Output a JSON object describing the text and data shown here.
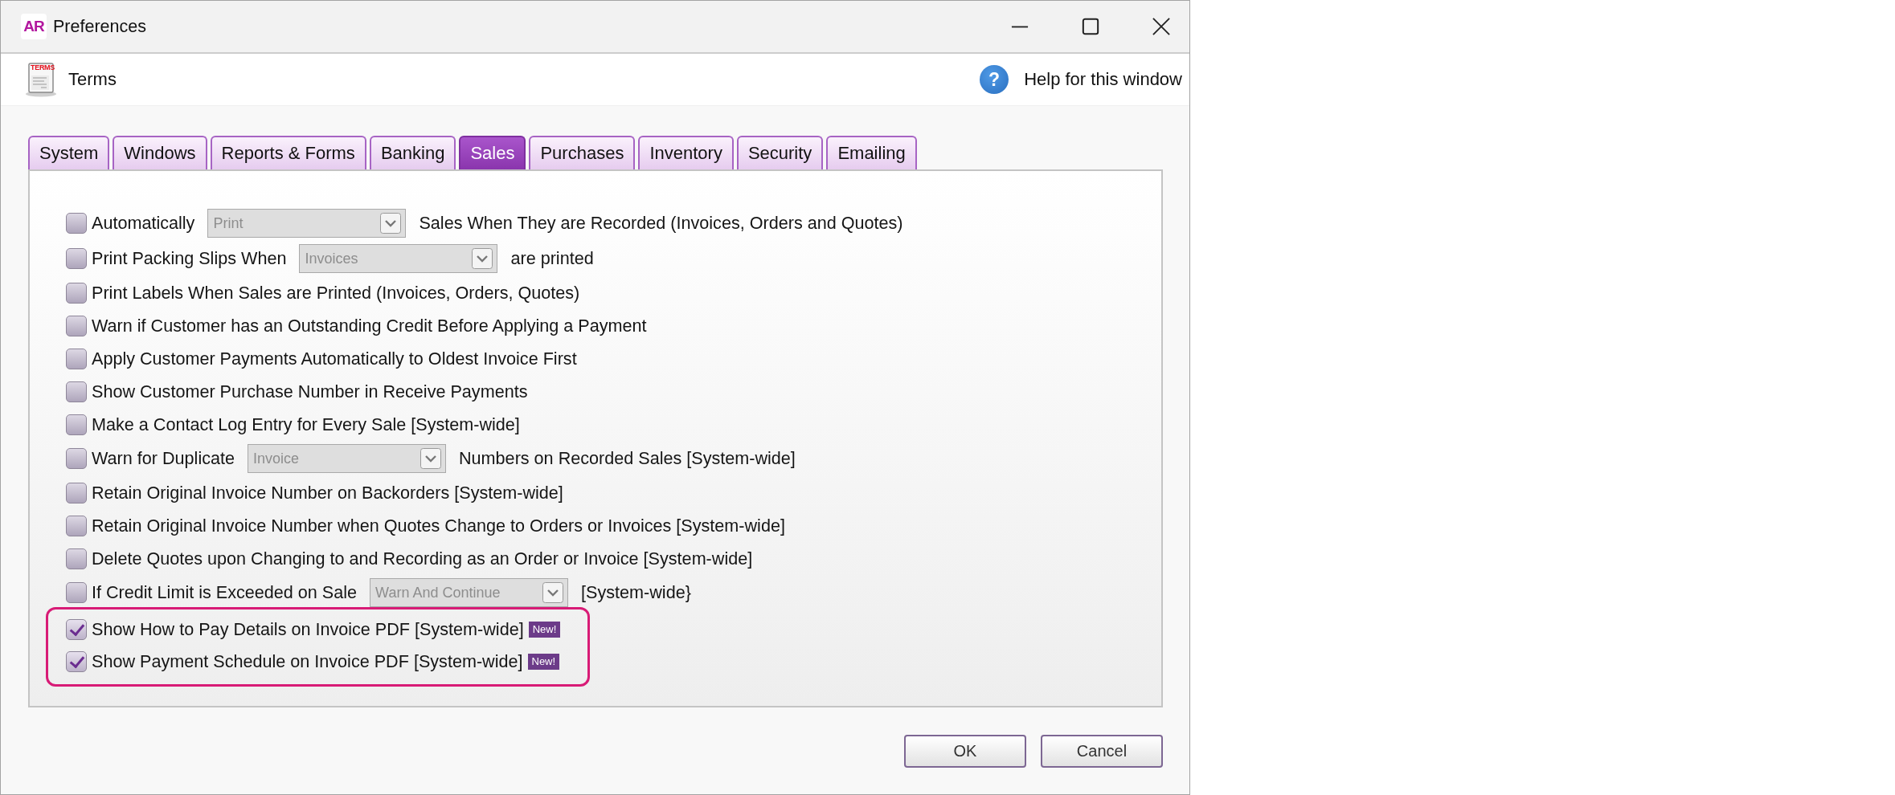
{
  "window": {
    "logo": "AR",
    "title": "Preferences"
  },
  "header": {
    "icon_text": "TERMS",
    "title": "Terms",
    "help_icon": "?",
    "help_link": "Help for this window"
  },
  "tabs": [
    {
      "label": "System",
      "selected": false
    },
    {
      "label": "Windows",
      "selected": false
    },
    {
      "label": "Reports & Forms",
      "selected": false
    },
    {
      "label": "Banking",
      "selected": false
    },
    {
      "label": "Sales",
      "selected": true
    },
    {
      "label": "Purchases",
      "selected": false
    },
    {
      "label": "Inventory",
      "selected": false
    },
    {
      "label": "Security",
      "selected": false
    },
    {
      "label": "Emailing",
      "selected": false
    }
  ],
  "options": [
    {
      "kind": "select",
      "checked": false,
      "highlighted": false,
      "label": "Automatically",
      "select": {
        "value": "Print",
        "disabled": true
      },
      "label_after": "Sales When They are Recorded (Invoices, Orders and Quotes)"
    },
    {
      "kind": "select",
      "checked": false,
      "highlighted": false,
      "label": "Print Packing Slips When",
      "select": {
        "value": "Invoices",
        "disabled": true
      },
      "label_after": "are printed"
    },
    {
      "kind": "plain",
      "checked": false,
      "highlighted": false,
      "label": "Print Labels When Sales are Printed (Invoices, Orders, Quotes)"
    },
    {
      "kind": "plain",
      "checked": false,
      "highlighted": false,
      "label": "Warn if Customer has an Outstanding Credit Before Applying a Payment"
    },
    {
      "kind": "plain",
      "checked": false,
      "highlighted": false,
      "label": "Apply Customer Payments Automatically to Oldest Invoice First"
    },
    {
      "kind": "plain",
      "checked": false,
      "highlighted": false,
      "label": "Show Customer Purchase Number in Receive Payments"
    },
    {
      "kind": "plain",
      "checked": false,
      "highlighted": false,
      "label": "Make a Contact Log Entry for Every Sale [System-wide]"
    },
    {
      "kind": "select",
      "checked": false,
      "highlighted": false,
      "label": "Warn for Duplicate",
      "select": {
        "value": "Invoice",
        "disabled": true
      },
      "label_after": "Numbers on Recorded Sales [System-wide]"
    },
    {
      "kind": "plain",
      "checked": false,
      "highlighted": false,
      "label": "Retain Original Invoice Number on Backorders [System-wide]"
    },
    {
      "kind": "plain",
      "checked": false,
      "highlighted": false,
      "label": "Retain Original Invoice Number when Quotes Change to Orders or Invoices [System-wide]"
    },
    {
      "kind": "plain",
      "checked": false,
      "highlighted": false,
      "label": "Delete Quotes upon Changing to and Recording as an Order or Invoice [System-wide]"
    },
    {
      "kind": "select",
      "checked": false,
      "highlighted": false,
      "label": "If Credit Limit is Exceeded on Sale",
      "select": {
        "value": "Warn And Continue",
        "disabled": true
      },
      "label_after": "[System-wide}"
    },
    {
      "kind": "plain",
      "checked": true,
      "highlighted": true,
      "label": "Show How to Pay Details on Invoice PDF [System-wide]",
      "badge": "New!"
    },
    {
      "kind": "plain",
      "checked": true,
      "highlighted": true,
      "label": "Show Payment Schedule on Invoice PDF [System-wide]",
      "badge": "New!"
    }
  ],
  "buttons": [
    {
      "label": "OK"
    },
    {
      "label": "Cancel"
    }
  ]
}
